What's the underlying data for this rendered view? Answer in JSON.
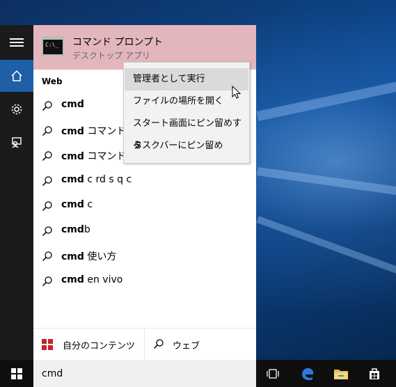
{
  "top_result": {
    "title": "コマンド プロンプト",
    "subtitle": "デスクトップ アプリ",
    "icon_text": "C:\\_"
  },
  "section_label": "Web",
  "suggestions": [
    {
      "bold": "cmd",
      "rest": ""
    },
    {
      "bold": "cmd",
      "rest": " コマンド一"
    },
    {
      "bold": "cmd",
      "rest": " コマンド"
    },
    {
      "bold": "cmd",
      "rest": " c rd s q c"
    },
    {
      "bold": "cmd",
      "rest": " c"
    },
    {
      "bold": "cmd",
      "rest": "b"
    },
    {
      "bold": "cmd",
      "rest": " 使い方"
    },
    {
      "bold": "cmd",
      "rest": " en vivo"
    }
  ],
  "context_menu": [
    "管理者として実行",
    "ファイルの場所を開く",
    "スタート画面にピン留めする",
    "タスクバーにピン留め"
  ],
  "bottom": {
    "my_content": "自分のコンテンツ",
    "web": "ウェブ"
  },
  "search": {
    "value": "cmd"
  },
  "colors": {
    "accent": "#1f5fa5",
    "top_result_bg": "#e3b6bd",
    "rail_bg": "#1b1b1b"
  }
}
